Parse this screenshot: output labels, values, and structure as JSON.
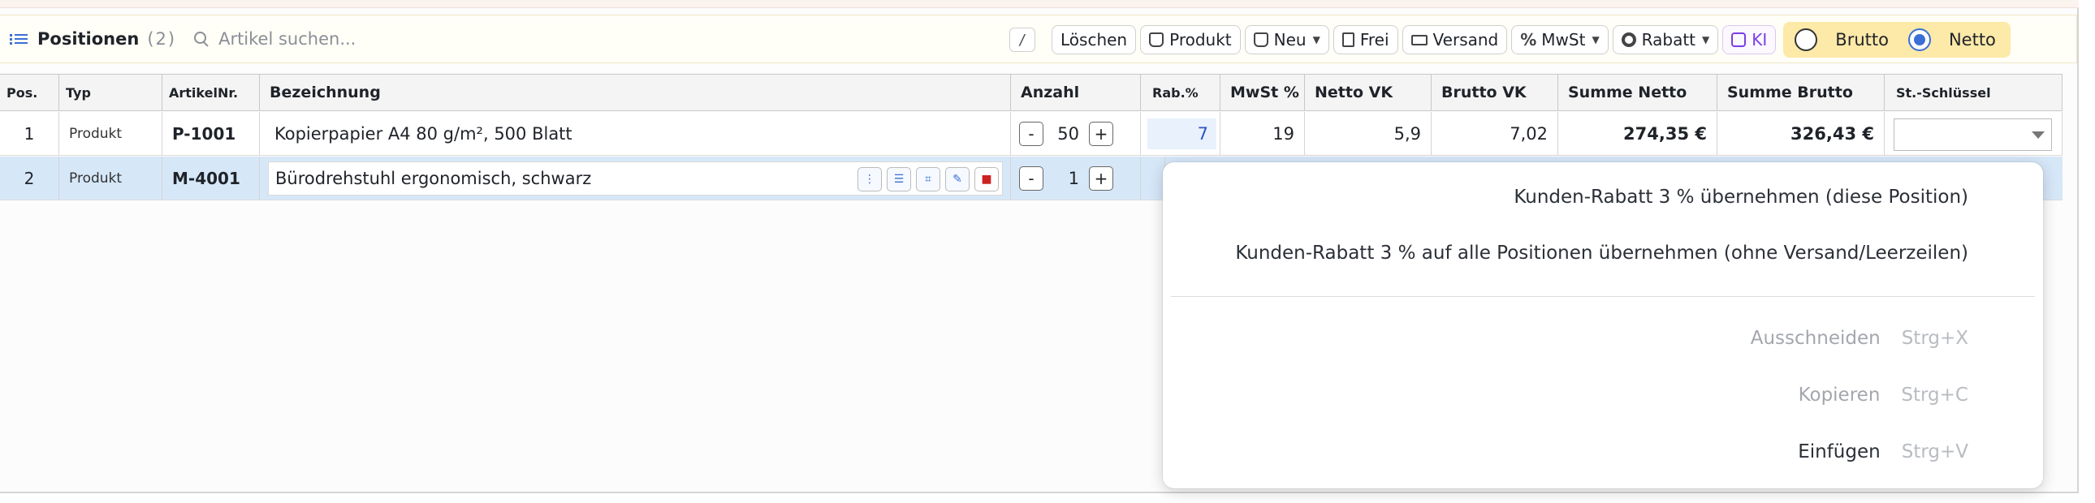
{
  "toolbar": {
    "title": "Positionen",
    "count": "(2)",
    "search_placeholder": "Artikel suchen...",
    "shortcut_hint": "/",
    "buttons": {
      "delete": "Löschen",
      "product": "Produkt",
      "new": "Neu",
      "free": "Frei",
      "shipping": "Versand",
      "vat": "MwSt",
      "discount": "Rabatt",
      "ai": "KI"
    },
    "price_mode": {
      "gross": "Brutto",
      "net": "Netto",
      "selected": "net"
    }
  },
  "table": {
    "headers": {
      "pos": "Pos.",
      "typ": "Typ",
      "artnr": "ArtikelNr.",
      "bezeichnung": "Bezeichnung",
      "anzahl": "Anzahl",
      "rabatt": "Rab.%",
      "mwst": "MwSt %",
      "netto_vk": "Netto VK",
      "brutto_vk": "Brutto VK",
      "summe_netto": "Summe Netto",
      "summe_brutto": "Summe Brutto",
      "steuerschluessel": "St.-Schlüssel"
    },
    "rows": [
      {
        "pos": "1",
        "typ": "Produkt",
        "artnr": "P-1001",
        "bezeichnung": "Kopierpapier A4 80 g/m², 500 Blatt",
        "anzahl": "50",
        "rabatt": "7",
        "mwst": "19",
        "netto_vk": "5,9",
        "brutto_vk": "7,02",
        "summe_netto": "274,35 €",
        "summe_brutto": "326,43 €"
      },
      {
        "pos": "2",
        "typ": "Produkt",
        "artnr": "M-4001",
        "bezeichnung": "Bürodrehstuhl ergonomisch, schwarz",
        "anzahl": "1"
      }
    ]
  },
  "context_menu": {
    "discount_this": "Kunden-Rabatt 3 % übernehmen (diese Position)",
    "discount_all": "Kunden-Rabatt 3 % auf alle Positionen übernehmen (ohne Versand/Leerzeilen)",
    "cut": "Ausschneiden",
    "cut_shortcut": "Strg+X",
    "copy": "Kopieren",
    "copy_shortcut": "Strg+C",
    "paste": "Einfügen",
    "paste_shortcut": "Strg+V"
  },
  "colors": {
    "accent": "#3b6fd6",
    "selected_row": "#d6e7f8",
    "toggle_bg": "#fde9a8",
    "ai": "#7b3fe4"
  }
}
